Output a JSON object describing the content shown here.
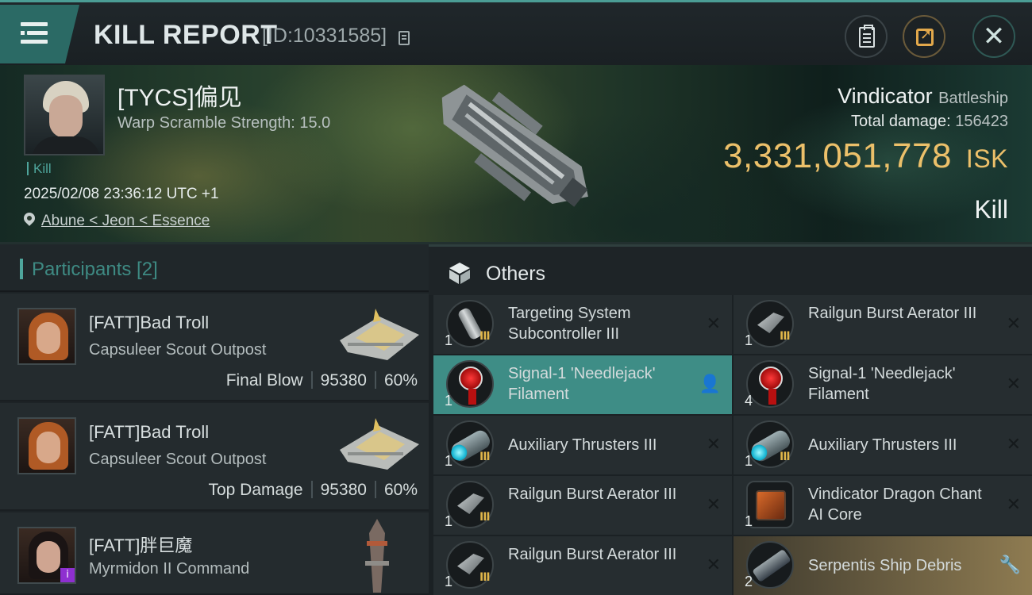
{
  "header": {
    "title": "KILL REPORT",
    "id_text": "[ID:10331585]",
    "icons": [
      "menu-icon",
      "copy-icon",
      "clipboard-icon",
      "share-icon",
      "close-icon"
    ]
  },
  "victim": {
    "name": "[TYCS]偏见",
    "scramble": "Warp Scramble Strength: 15.0",
    "tag": "Kill",
    "timestamp": "2025/02/08 23:36:12 UTC +1",
    "location": "Abune < Jeon < Essence",
    "ship_name": "Vindicator",
    "ship_class": "Battleship",
    "total_damage_label": "Total damage:",
    "total_damage": "156423",
    "isk_value": "3,331,051,778",
    "isk_unit": "ISK",
    "result": "Kill"
  },
  "participants": {
    "title": "Participants [2]",
    "rows": [
      {
        "name": "[FATT]Bad Troll",
        "ship": "Capsuleer Scout Outpost",
        "role": "Final Blow",
        "damage": "95380",
        "percent": "60%"
      },
      {
        "name": "[FATT]Bad Troll",
        "ship": "Capsuleer Scout Outpost",
        "role": "Top Damage",
        "damage": "95380",
        "percent": "60%"
      },
      {
        "name": "[FATT]胖巨魔",
        "ship": "Myrmidon II Command",
        "badge": "i"
      }
    ]
  },
  "others": {
    "title": "Others",
    "tier_mark": "III",
    "items": [
      {
        "qty": "1",
        "name": "Targeting System Subcontroller III",
        "icon": "targeting-subcontroller-icon",
        "action": "destroyed"
      },
      {
        "qty": "1",
        "name": "Railgun Burst Aerator III",
        "icon": "railgun-aerator-icon",
        "action": "destroyed"
      },
      {
        "qty": "1",
        "name": "Signal-1 'Needlejack' Filament",
        "icon": "filament-icon",
        "action": "user",
        "highlight": "teal"
      },
      {
        "qty": "4",
        "name": "Signal-1 'Needlejack' Filament",
        "icon": "filament-icon",
        "action": "destroyed"
      },
      {
        "qty": "1",
        "name": "Auxiliary Thrusters III",
        "icon": "thruster-icon",
        "action": "destroyed"
      },
      {
        "qty": "1",
        "name": "Auxiliary Thrusters III",
        "icon": "thruster-icon",
        "action": "destroyed"
      },
      {
        "qty": "1",
        "name": "Railgun Burst Aerator III",
        "icon": "railgun-aerator-icon",
        "action": "destroyed"
      },
      {
        "qty": "1",
        "name": "Vindicator Dragon Chant AI Core",
        "icon": "ai-core-icon",
        "action": "destroyed"
      },
      {
        "qty": "1",
        "name": "Railgun Burst Aerator III",
        "icon": "railgun-aerator-icon",
        "action": "destroyed"
      },
      {
        "qty": "2",
        "name": "Serpentis Ship Debris",
        "icon": "ship-debris-icon",
        "action": "wrench",
        "highlight": "gold"
      }
    ]
  },
  "colors": {
    "accent": "#4ea59c",
    "isk": "#ecc06a",
    "highlight_teal": "#3e8d86",
    "highlight_gold": "#8e7b51"
  }
}
